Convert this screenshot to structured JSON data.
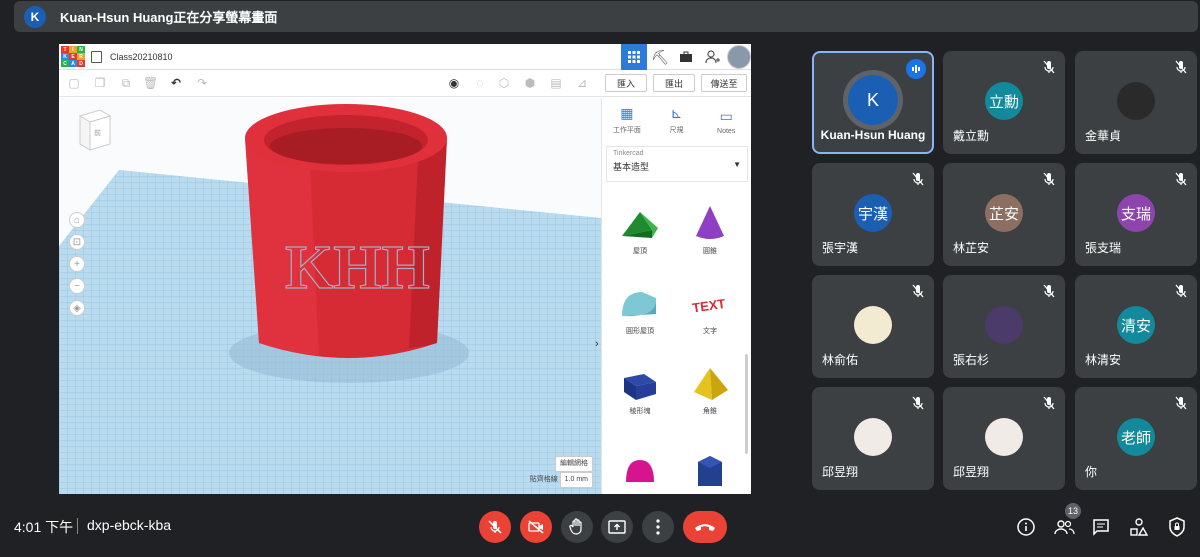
{
  "banner": {
    "avatar_letter": "K",
    "text": "Kuan-Hsun Huang正在分享螢幕畫面"
  },
  "tinkercad": {
    "logo_letters": [
      "T",
      "I",
      "N",
      "K",
      "E",
      "R",
      "C",
      "A",
      "D"
    ],
    "logo_colors": [
      "#e8382b",
      "#e8a52b",
      "#2bb34a",
      "#2b8ce8",
      "#e8382b",
      "#e8a52b",
      "#2bb34a",
      "#2b8ce8",
      "#e8382b"
    ],
    "design_name": "Class20210810",
    "actions": {
      "import": "匯入",
      "export": "匯出",
      "send_to": "傳送至"
    },
    "view_tools": {
      "workplane": "工作平面",
      "ruler": "尺規",
      "notes": "Notes"
    },
    "library": {
      "source": "Tinkercad",
      "selected": "基本造型"
    },
    "navcube_label": "前",
    "model_text": "KHH",
    "grid_info": {
      "edit_grid": "編輯網格",
      "snap_label": "貼齊格線",
      "snap_value": "1.0 mm"
    },
    "shapes": [
      {
        "label": "屋頂"
      },
      {
        "label": "圓錐"
      },
      {
        "label": "圓形屋頂"
      },
      {
        "label": "文字"
      },
      {
        "label": "稜形塊"
      },
      {
        "label": "角錐"
      }
    ],
    "text_shape_glyph": "TEXT"
  },
  "participants": [
    {
      "name": "Kuan-Hsun Huang",
      "avatar": "K",
      "color": "#1a5fb4",
      "speaking": true
    },
    {
      "name": "戴立勳",
      "avatar": "立勳",
      "color": "#128a9c",
      "speaking": false
    },
    {
      "name": "金華貞",
      "avatar": "",
      "color": "#2a2a2a",
      "speaking": false
    },
    {
      "name": "張宇漢",
      "avatar": "宇漢",
      "color": "#1a5fb4",
      "speaking": false
    },
    {
      "name": "林芷安",
      "avatar": "芷安",
      "color": "#8d6e63",
      "speaking": false
    },
    {
      "name": "張支瑞",
      "avatar": "支瑞",
      "color": "#8e44ad",
      "speaking": false
    },
    {
      "name": "林俞佑",
      "avatar": "",
      "color": "#f3ead2",
      "speaking": false
    },
    {
      "name": "張右杉",
      "avatar": "",
      "color": "#4a3b6b",
      "speaking": false
    },
    {
      "name": "林清安",
      "avatar": "清安",
      "color": "#128a9c",
      "speaking": false
    },
    {
      "name": "邱昱翔",
      "avatar": "",
      "color": "#f0ebe6",
      "speaking": false
    },
    {
      "name": "邱昱翔",
      "avatar": "",
      "color": "#f0ebe6",
      "speaking": false
    },
    {
      "name": "你",
      "avatar": "老師",
      "color": "#128a9c",
      "speaking": false
    }
  ],
  "bottom": {
    "time": "4:01 下午",
    "meeting_code": "dxp-ebck-kba",
    "people_count": "13"
  }
}
